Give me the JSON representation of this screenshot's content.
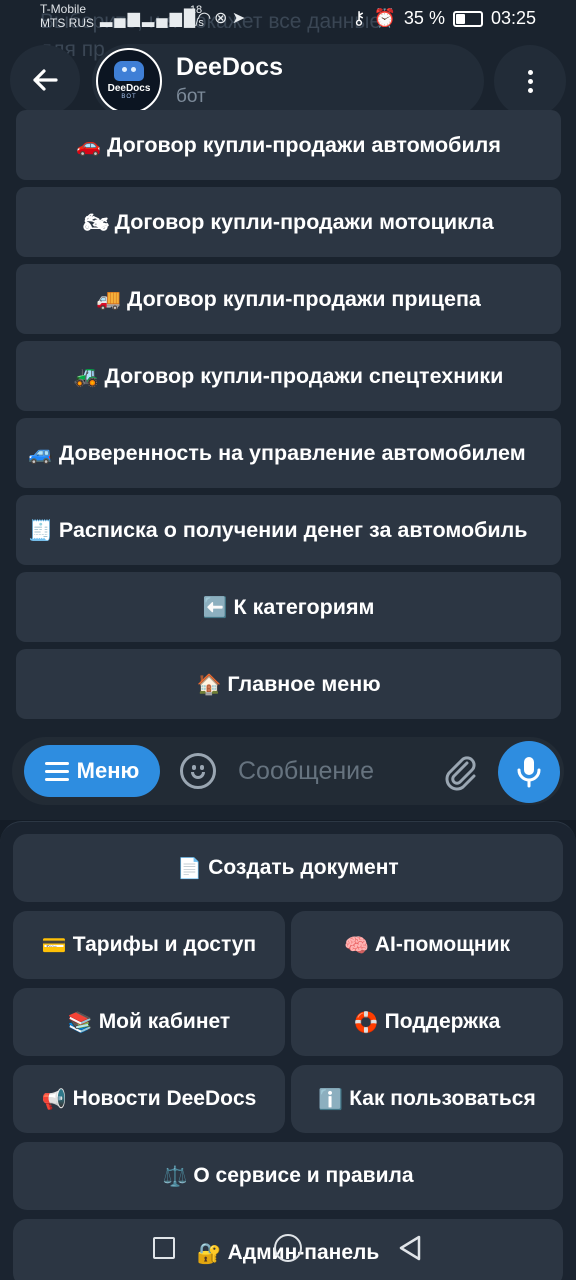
{
  "status_bar": {
    "carrier_1": "T-Mobile",
    "carrier_2": "MTS RUS",
    "speed_value": "18",
    "speed_unit": "B/s",
    "battery_percent": "35 %",
    "battery_level": 0.35,
    "time": "03:25"
  },
  "background": {
    "ghost_text_1": "Выберите, и я покажет все данные",
    "ghost_text_2": "для пр"
  },
  "header": {
    "bot_name": "DeeDocs",
    "bot_status": "бот",
    "avatar_text": "DeeDocs",
    "avatar_sub": "BOT"
  },
  "inline_keyboard": [
    {
      "emoji": "🚗",
      "label": "Договор купли-продажи автомобиля"
    },
    {
      "emoji": "🏍",
      "label": "Договор купли-продажи мотоцикла"
    },
    {
      "emoji": "🚚",
      "label": "Договор купли-продажи прицепа"
    },
    {
      "emoji": "🚜",
      "label": "Договор купли-продажи спецтехники"
    },
    {
      "emoji": "🚙",
      "label": "Доверенность на управление автомобилем"
    },
    {
      "emoji": "🧾",
      "label": "Расписка о получении денег за автомобиль"
    },
    {
      "emoji": "⬅️",
      "label": "К категориям"
    },
    {
      "emoji": "🏠",
      "label": "Главное меню"
    }
  ],
  "composer": {
    "menu_label": "Меню",
    "placeholder": "Сообщение"
  },
  "reply_keyboard": {
    "create_doc": {
      "emoji": "📄",
      "label": "Создать документ"
    },
    "tariffs": {
      "emoji": "💳",
      "label": "Тарифы и доступ"
    },
    "ai_helper": {
      "emoji": "🧠",
      "label": "AI-помощник"
    },
    "cabinet": {
      "emoji": "📚",
      "label": "Мой кабинет"
    },
    "support": {
      "emoji": "🛟",
      "label": "Поддержка"
    },
    "news": {
      "emoji": "📢",
      "label": "Новости DeeDocs"
    },
    "how_to": {
      "emoji": "ℹ️",
      "label": "Как пользоваться"
    },
    "about": {
      "emoji": "⚖️",
      "label": "О сервисе и правила"
    },
    "admin": {
      "emoji": "🔐",
      "label": "Админ-панель"
    }
  },
  "colors": {
    "accent": "#2e8de0",
    "button_bg": "#2c3643",
    "chat_bg": "#1a232e",
    "keyboard_bg": "#1b2430"
  }
}
